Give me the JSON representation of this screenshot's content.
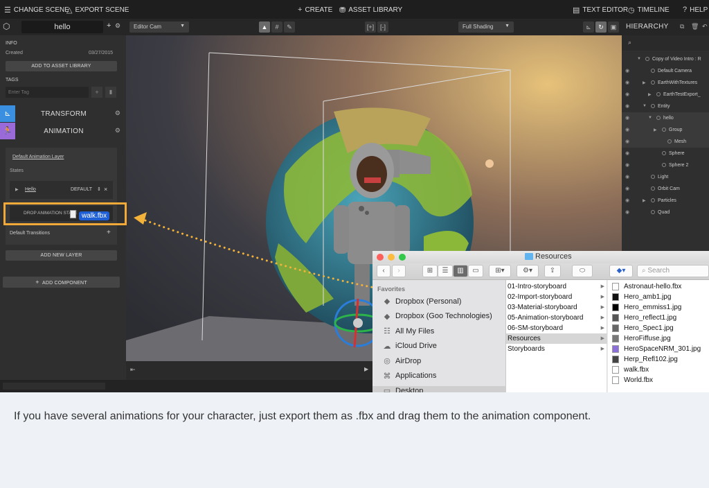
{
  "topbar": {
    "change_scene": "CHANGE SCENE",
    "export_scene": "EXPORT SCENE",
    "create": "CREATE",
    "asset_library": "ASSET LIBRARY",
    "text_editor": "TEXT EDITOR",
    "timeline": "TIMELINE",
    "help": "HELP"
  },
  "subbar": {
    "entity_name": "hello",
    "camera": "Editor Cam",
    "shading": "Full Shading",
    "hierarchy_title": "HIERARCHY"
  },
  "left": {
    "info_label": "INFO",
    "created_label": "Created",
    "created_date": "03/27/2015",
    "add_to_asset_library": "ADD TO ASSET LIBRARY",
    "tags_label": "TAGS",
    "tag_placeholder": "Enter Tag",
    "transform": "TRANSFORM",
    "animation": "ANIMATION",
    "default_anim_layer": "Default Animation Layer",
    "states_label": "States",
    "state_name": "Hello",
    "state_default": "DEFAULT",
    "drop_animation": "DROP ANIMATION STATE",
    "default_transitions": "Default Transitions",
    "add_new_layer": "ADD NEW LAYER",
    "add_component": "ADD COMPONENT"
  },
  "drag": {
    "file": "walk.fbx"
  },
  "hierarchy": {
    "items": [
      {
        "label": "Copy of Video Intro : R",
        "indent": 0
      },
      {
        "label": "Default Camera",
        "indent": 1
      },
      {
        "label": "EarthWithTextures",
        "indent": 1
      },
      {
        "label": "EarthTestExport_",
        "indent": 2
      },
      {
        "label": "Entity",
        "indent": 1
      },
      {
        "label": "hello",
        "indent": 2
      },
      {
        "label": "Group",
        "indent": 3
      },
      {
        "label": "Mesh",
        "indent": 4
      },
      {
        "label": "Sphere",
        "indent": 3
      },
      {
        "label": "Sphere 2",
        "indent": 3
      },
      {
        "label": "Light",
        "indent": 1
      },
      {
        "label": "Orbit Cam",
        "indent": 1
      },
      {
        "label": "Particles",
        "indent": 1
      },
      {
        "label": "Quad",
        "indent": 1
      }
    ]
  },
  "finder": {
    "title": "Resources",
    "search_placeholder": "Search",
    "favorites_label": "Favorites",
    "sidebar": [
      "Dropbox (Personal)",
      "Dropbox (Goo Technologies)",
      "All My Files",
      "iCloud Drive",
      "AirDrop",
      "Applications",
      "Desktop"
    ],
    "col1": [
      "01-Intro-storyboard",
      "02-Import-storyboard",
      "03-Material-storyboard",
      "05-Animation-storyboard",
      "06-SM-storyboard",
      "Resources",
      "Storyboards"
    ],
    "col2": [
      "Astronaut-hello.fbx",
      "Hero_amb1.jpg",
      "Hero_emmiss1.jpg",
      "Hero_reflect1.jpg",
      "Hero_Spec1.jpg",
      "HeroFiffuse.jpg",
      "HeroSpaceNRM_301.jpg",
      "Herp_Refl102.jpg",
      "walk.fbx",
      "World.fbx"
    ]
  },
  "caption": "If you have several animations for your character, just export them as .fbx and drag them to the animation component."
}
